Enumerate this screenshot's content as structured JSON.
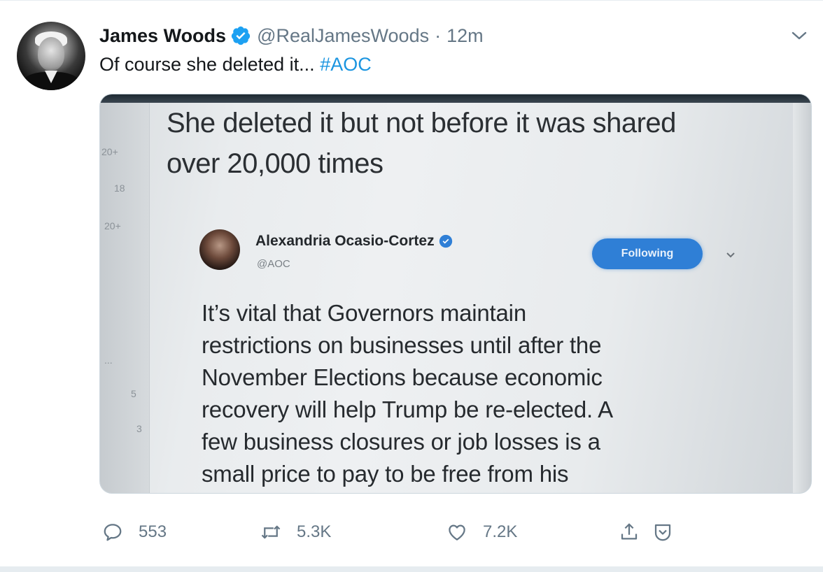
{
  "tweet": {
    "author_name": "James Woods",
    "author_handle": "@RealJamesWoods",
    "separator": "·",
    "timestamp": "12m",
    "text": "Of course she deleted it...",
    "hashtag": "#AOC",
    "colors": {
      "hashtag": "#1b95e0",
      "verified": "#1da1f2",
      "secondary": "#657786"
    }
  },
  "media": {
    "headline_line1": "She deleted it but not before it was shared",
    "headline_line2": "over 20,000 times",
    "side_numbers": [
      "20+",
      "18",
      "20+",
      "...",
      "5",
      "3"
    ],
    "embedded_tweet": {
      "name": "Alexandria Ocasio-Cortez",
      "handle": "@AOC",
      "follow_button": "Following",
      "body_lines": [
        "It’s vital that Governors maintain",
        "restrictions on businesses until after the",
        "November Elections because economic",
        "recovery will help Trump be re-elected. A",
        "few business closures or job losses is a",
        "small price to pay to be free from his"
      ]
    }
  },
  "actions": {
    "reply_count": "553",
    "retweet_count": "5.3K",
    "like_count": "7.2K"
  },
  "icons": [
    "verified-badge-icon",
    "chevron-down-icon",
    "reply-icon",
    "retweet-icon",
    "like-icon",
    "share-icon",
    "promote-icon"
  ]
}
